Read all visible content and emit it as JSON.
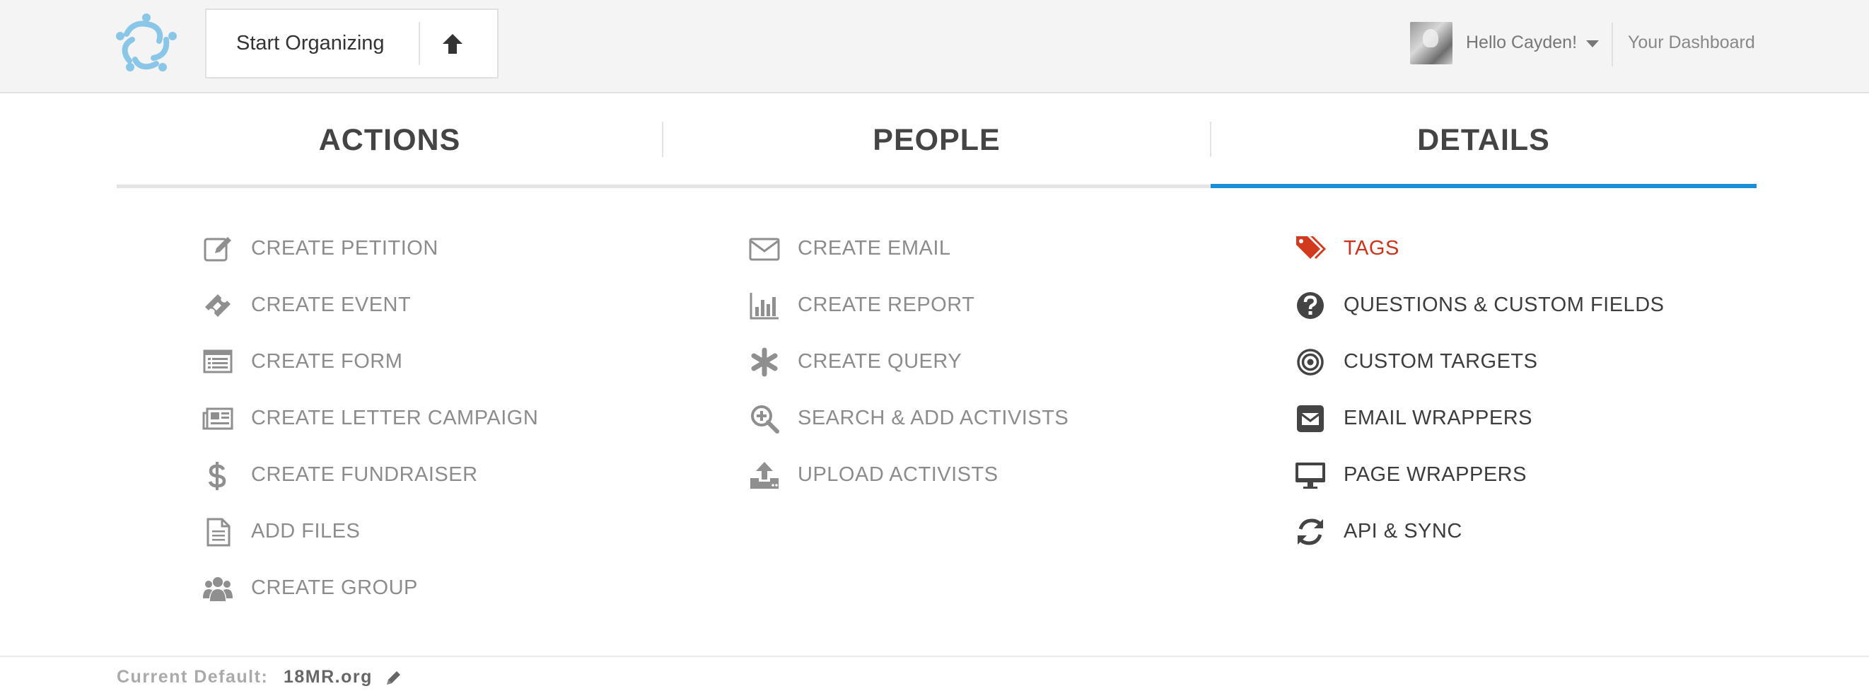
{
  "header": {
    "org_name": "Start Organizing",
    "greeting": "Hello Cayden!",
    "dashboard_link": "Your Dashboard",
    "logo_icon": "circle-of-people-logo",
    "logo_color": "#8ac6e8"
  },
  "tabs": [
    {
      "label": "ACTIONS",
      "active": false
    },
    {
      "label": "PEOPLE",
      "active": false
    },
    {
      "label": "DETAILS",
      "active": true
    }
  ],
  "accent_color": "#1a8fd7",
  "columns": {
    "actions": [
      {
        "label": "CREATE PETITION",
        "icon": "edit-icon"
      },
      {
        "label": "CREATE EVENT",
        "icon": "ticket-icon"
      },
      {
        "label": "CREATE FORM",
        "icon": "form-list-icon"
      },
      {
        "label": "CREATE LETTER CAMPAIGN",
        "icon": "newspaper-icon"
      },
      {
        "label": "CREATE FUNDRAISER",
        "icon": "dollar-icon"
      },
      {
        "label": "ADD FILES",
        "icon": "file-text-icon"
      },
      {
        "label": "CREATE GROUP",
        "icon": "users-icon"
      }
    ],
    "people": [
      {
        "label": "CREATE EMAIL",
        "icon": "envelope-icon"
      },
      {
        "label": "CREATE REPORT",
        "icon": "bar-chart-icon"
      },
      {
        "label": "CREATE QUERY",
        "icon": "asterisk-icon"
      },
      {
        "label": "SEARCH & ADD ACTIVISTS",
        "icon": "search-plus-icon"
      },
      {
        "label": "UPLOAD ACTIVISTS",
        "icon": "upload-icon"
      }
    ],
    "details": [
      {
        "label": "TAGS",
        "icon": "tags-icon",
        "highlight_color": "#c9341a"
      },
      {
        "label": "QUESTIONS & CUSTOM FIELDS",
        "icon": "question-circle-icon"
      },
      {
        "label": "CUSTOM TARGETS",
        "icon": "bullseye-icon"
      },
      {
        "label": "EMAIL WRAPPERS",
        "icon": "envelope-square-icon"
      },
      {
        "label": "PAGE WRAPPERS",
        "icon": "desktop-icon"
      },
      {
        "label": "API & SYNC",
        "icon": "refresh-icon"
      }
    ]
  },
  "footer": {
    "default_label": "Current Default:",
    "default_value": "18MR.org"
  }
}
